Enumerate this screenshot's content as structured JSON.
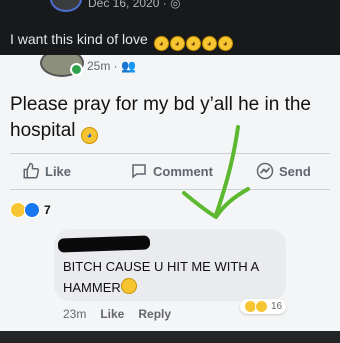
{
  "header": {
    "date": "Dec 16, 2020 · ",
    "caption": "I want this kind of love"
  },
  "post": {
    "time": "25m · ",
    "text": "Please pray for my bd y’all he in the hospital",
    "actions": {
      "like": "Like",
      "comment": "Comment",
      "send": "Send"
    },
    "reaction_count": "7"
  },
  "comment": {
    "text": "BITCH CAUSE U HIT ME WITH A HAMMER",
    "time": "23m",
    "like": "Like",
    "reply": "Reply",
    "reaction_count": "16"
  },
  "colors": {
    "arrow": "#5cb82f",
    "emoji": "#f7c531"
  }
}
